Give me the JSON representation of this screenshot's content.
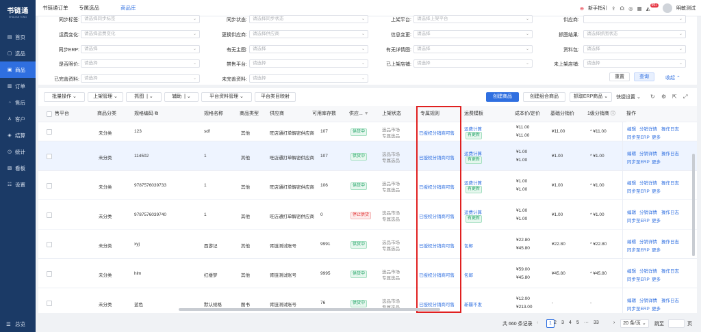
{
  "app": {
    "logo": "书链通",
    "logo_sub": "SHULIAN TONG"
  },
  "sidebar": {
    "items": [
      {
        "icon": "▤",
        "label": "首页"
      },
      {
        "icon": "▢",
        "label": "选品"
      },
      {
        "icon": "▣",
        "label": "商品"
      },
      {
        "icon": "▥",
        "label": "订单"
      },
      {
        "icon": "◔",
        "label": "售后"
      },
      {
        "icon": "♙",
        "label": "客户"
      },
      {
        "icon": "◈",
        "label": "结算"
      },
      {
        "icon": "◷",
        "label": "统计"
      },
      {
        "icon": "▧",
        "label": "看板"
      },
      {
        "icon": "☷",
        "label": "设置"
      }
    ],
    "footer": "总览",
    "active_index": 2
  },
  "topbar": {
    "tabs": [
      "书链通订单",
      "专属选品",
      "商品库"
    ],
    "active_tab": 2,
    "guide": "新手指引",
    "badge": "99+",
    "user": "明敏测试"
  },
  "filters": {
    "row0": [
      {
        "label": "同步标签:",
        "placeholder": "请选择同步标签"
      },
      {
        "label": "同步状态:",
        "placeholder": "请选择同步状态"
      },
      {
        "label": "上架平台:",
        "placeholder": "请选择上架平台"
      },
      {
        "label": "供应商:",
        "placeholder": ""
      }
    ],
    "row1": [
      {
        "label": "运费变化:",
        "placeholder": "请选择运费变化"
      },
      {
        "label": "更换供应商:",
        "placeholder": "请选择供应商"
      },
      {
        "label": "信息变更:",
        "placeholder": "请选择"
      },
      {
        "label": "抓图结果:",
        "placeholder": "请选择抓图状态"
      }
    ],
    "row2": [
      {
        "label": "同步ERP:",
        "placeholder": "请选择"
      },
      {
        "label": "有无主图:",
        "placeholder": "请选择"
      },
      {
        "label": "有无详情图:",
        "placeholder": "请选择"
      },
      {
        "label": "资料包:",
        "placeholder": "请选择"
      }
    ],
    "row3": [
      {
        "label": "是否限价:",
        "placeholder": "请选择"
      },
      {
        "label": "禁售平台:",
        "placeholder": "请选择"
      },
      {
        "label": "已上架店铺:",
        "placeholder": "请选择"
      },
      {
        "label": "未上架店铺:",
        "placeholder": "请选择"
      }
    ],
    "row4": [
      {
        "label": "已完善资料:",
        "placeholder": "请选择"
      },
      {
        "label": "未完善资料:",
        "placeholder": "请选择"
      }
    ],
    "reset": "重置",
    "query": "查询",
    "collapse": "收起"
  },
  "toolbar": {
    "batch": "批量操作",
    "shelf": "上架管理",
    "capture": "抓图",
    "assist": "辅助",
    "platform_mgmt": "平台资料管理",
    "platform_map": "平台类目映射",
    "create": "创建商品",
    "create_combo": "创建组合商品",
    "capture_erp": "抓取ERP商品",
    "quick_settings": "快捷设置"
  },
  "table": {
    "headers": [
      "售平台",
      "商品分类",
      "规格编码",
      "规格名称",
      "商品类型",
      "供应商",
      "可用库存数",
      "供应...",
      "上架状态",
      "专属规则",
      "运费模板",
      "成本价/定价",
      "基础分销价",
      "1级分销商",
      "操作"
    ],
    "rows": [
      {
        "category": "未分类",
        "code": "123",
        "spec": "sdf",
        "type": "其他",
        "supplier": "旺店通打单解密供应商",
        "stock": "107",
        "status": "供货中",
        "status_color": "green",
        "shelf1": "选品市场",
        "shelf2": "专属选品",
        "rule": "已授权分销商可售",
        "freight": "运费计算",
        "freight_tag": "有更新",
        "cost": "¥11.00",
        "price": "¥11.00",
        "base": "¥11.00",
        "dist": "* ¥11.00",
        "op1": "编辑",
        "op2": "分销详情",
        "op3": "操作日志",
        "op4": "同步至ERP",
        "op5": "更多"
      },
      {
        "category": "未分类",
        "code": "114502",
        "spec": "1",
        "type": "其他",
        "supplier": "旺店通打单解密供应商",
        "stock": "107",
        "status": "供货中",
        "status_color": "green",
        "shelf1": "选品市场",
        "shelf2": "专属选品",
        "rule": "已授权分销商可售",
        "freight": "运费计算",
        "freight_tag": "有更新",
        "cost": "¥1.00",
        "price": "¥1.00",
        "base": "¥1.00",
        "dist": "* ¥1.00",
        "op1": "编辑",
        "op2": "分销详情",
        "op3": "操作日志",
        "op4": "同步至ERP",
        "op5": "更多"
      },
      {
        "category": "未分类",
        "code": "9787576039733",
        "spec": "1",
        "type": "其他",
        "supplier": "旺店通打单解密供应商",
        "stock": "106",
        "status": "供货中",
        "status_color": "green",
        "shelf1": "选品市场",
        "shelf2": "专属选品",
        "rule": "已授权分销商可售",
        "freight": "运费计算",
        "freight_tag": "有更新",
        "cost": "¥1.00",
        "price": "¥1.00",
        "base": "¥1.00",
        "dist": "* ¥1.00",
        "op1": "编辑",
        "op2": "分销详情",
        "op3": "操作日志",
        "op4": "同步至ERP",
        "op5": "更多"
      },
      {
        "category": "未分类",
        "code": "9787576039740",
        "spec": "1",
        "type": "其他",
        "supplier": "旺店通打单解密供应商",
        "stock": "0",
        "status": "停止供货",
        "status_color": "red",
        "shelf1": "选品市场",
        "shelf2": "专属选品",
        "rule": "已授权分销商可售",
        "freight": "运费计算",
        "freight_tag": "有更新",
        "cost": "¥1.00",
        "price": "¥1.00",
        "base": "¥1.00",
        "dist": "* ¥1.00",
        "op1": "编辑",
        "op2": "分销详情",
        "op3": "操作日志",
        "op4": "同步至ERP",
        "op5": "更多"
      },
      {
        "category": "未分类",
        "code": "xyj",
        "spec": "西游记",
        "type": "其他",
        "supplier": "胥链测试账号",
        "stock": "9991",
        "status": "供货中",
        "status_color": "green",
        "shelf1": "选品市场",
        "shelf2": "专属选品",
        "rule": "已授权分销商可售",
        "freight": "包邮",
        "freight_tag": "",
        "cost": "¥22.80",
        "price": "¥45.80",
        "base": "¥22.80",
        "dist": "* ¥22.80",
        "op1": "编辑",
        "op2": "分销详情",
        "op3": "操作日志",
        "op4": "同步至ERP",
        "op5": "更多"
      },
      {
        "category": "未分类",
        "code": "hlm",
        "spec": "红楼梦",
        "type": "其他",
        "supplier": "胥链测试账号",
        "stock": "9995",
        "status": "供货中",
        "status_color": "green",
        "shelf1": "选品市场",
        "shelf2": "专属选品",
        "rule": "已授权分销商可售",
        "freight": "包邮",
        "freight_tag": "",
        "cost": "¥59.00",
        "price": "¥45.80",
        "base": "¥45.80",
        "dist": "* ¥45.80",
        "op1": "编辑",
        "op2": "分销详情",
        "op3": "操作日志",
        "op4": "同步至ERP",
        "op5": "更多"
      },
      {
        "category": "未分类",
        "code": "蓝色",
        "spec": "默认规格",
        "type": "图书",
        "supplier": "胥链测试账号",
        "stock": "76",
        "status": "供货中",
        "status_color": "green",
        "shelf1": "选品市场",
        "shelf2": "专属选品",
        "rule": "已授权分销商可售",
        "freight": "新疆不发",
        "freight_tag": "",
        "cost": "¥12.00",
        "price": "¥213.00",
        "base": "-",
        "dist": "-",
        "op1": "编辑",
        "op2": "分销详情",
        "op3": "操作日志",
        "op4": "同步至ERP",
        "op5": "更多"
      }
    ]
  },
  "pager": {
    "total": "共 660 条记录",
    "pages": [
      "1",
      "2",
      "3",
      "4",
      "5",
      "···",
      "33"
    ],
    "current": "1",
    "per_page": "20 条/页",
    "jump": "跳至",
    "page_suffix": "页"
  }
}
